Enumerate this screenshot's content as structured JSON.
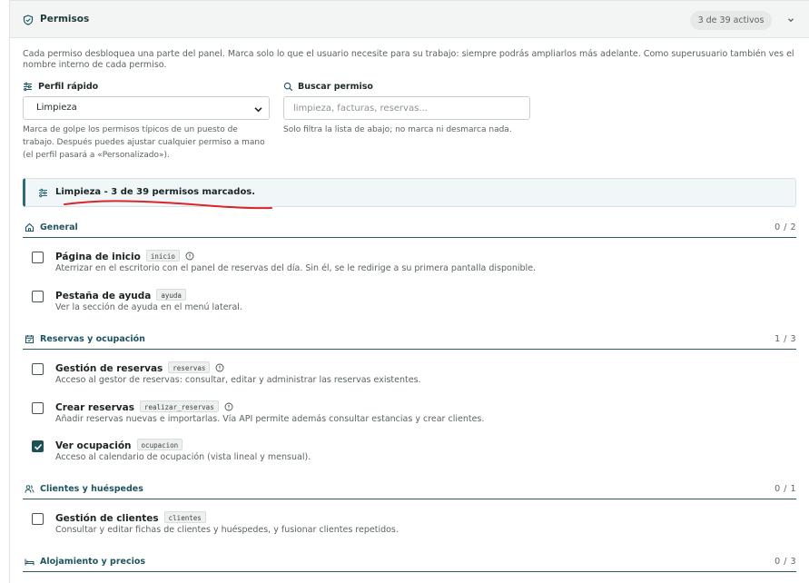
{
  "header": {
    "title": "Permisos",
    "badge": "3 de 39 activos"
  },
  "intro": "Cada permiso desbloquea una parte del panel. Marca solo lo que el usuario necesite para su trabajo: siempre podrás ampliarlos más adelante. Como superusuario también ves el nombre interno de cada permiso.",
  "profile": {
    "label": "Perfil rápido",
    "selected": "Limpieza",
    "help": "Marca de golpe los permisos típicos de un puesto de trabajo. Después puedes ajustar cualquier permiso a mano (el perfil pasará a «Personalizado»)."
  },
  "search": {
    "label": "Buscar permiso",
    "placeholder": "limpieza, facturas, reservas...",
    "help": "Solo filtra la lista de abajo; no marca ni desmarca nada."
  },
  "summary": {
    "text": "Limpieza - 3 de 39 permisos marcados."
  },
  "sections": [
    {
      "title": "General",
      "count": "0 / 2",
      "icon": "home-icon",
      "items": [
        {
          "title": "Página de inicio",
          "code": "inicio",
          "info": true,
          "checked": false,
          "desc": "Aterrizar en el escritorio con el panel de reservas del día. Sin él, se le redirige a su primera pantalla disponible."
        },
        {
          "title": "Pestaña de ayuda",
          "code": "ayuda",
          "info": false,
          "checked": false,
          "desc": "Ver la sección de ayuda en el menú lateral."
        }
      ]
    },
    {
      "title": "Reservas y ocupación",
      "count": "1 / 3",
      "icon": "calendar-icon",
      "items": [
        {
          "title": "Gestión de reservas",
          "code": "reservas",
          "info": true,
          "checked": false,
          "desc": "Acceso al gestor de reservas: consultar, editar y administrar las reservas existentes."
        },
        {
          "title": "Crear reservas",
          "code": "realizar_reservas",
          "info": true,
          "checked": false,
          "desc": "Añadir reservas nuevas e importarlas. Vía API permite además consultar estancias y crear clientes."
        },
        {
          "title": "Ver ocupación",
          "code": "ocupacion",
          "info": false,
          "checked": true,
          "desc": "Acceso al calendario de ocupación (vista lineal y mensual)."
        }
      ]
    },
    {
      "title": "Clientes y huéspedes",
      "count": "0 / 1",
      "icon": "users-icon",
      "items": [
        {
          "title": "Gestión de clientes",
          "code": "clientes",
          "info": false,
          "checked": false,
          "desc": "Consultar y editar fichas de clientes y huéspedes, y fusionar clientes repetidos."
        }
      ]
    },
    {
      "title": "Alojamiento y precios",
      "count": "0 / 3",
      "icon": "bed-icon",
      "items": []
    }
  ],
  "colors": {
    "accent": "#1f5560",
    "checked": "#1e5058",
    "underline": "#d8262b"
  }
}
